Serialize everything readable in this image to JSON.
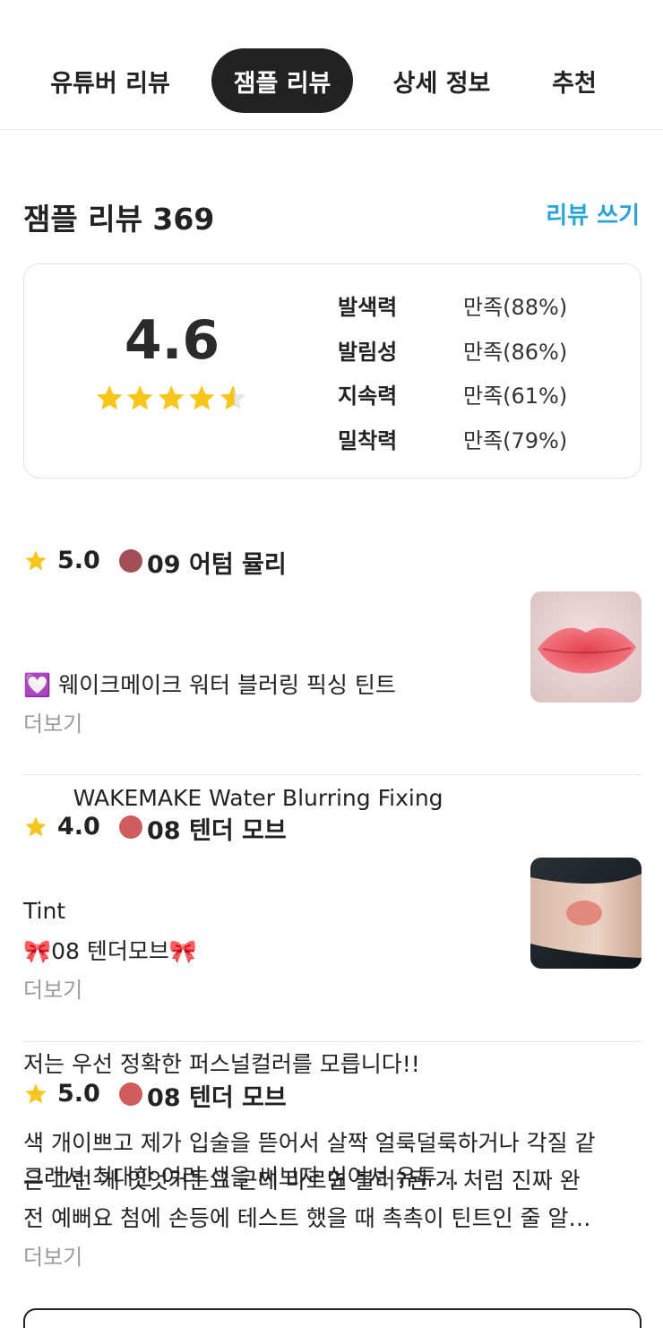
{
  "tabs": [
    {
      "label": "유튜버 리뷰",
      "active": false
    },
    {
      "label": "잼플 리뷰",
      "active": true
    },
    {
      "label": "상세 정보",
      "active": false
    },
    {
      "label": "추천",
      "active": false
    }
  ],
  "header": {
    "title": "잼플 리뷰 369",
    "write_link": "리뷰 쓰기"
  },
  "summary": {
    "average": "4.6",
    "average_value": 4.6,
    "star_count": 5,
    "stats": [
      {
        "label": "발색력",
        "value": "만족(88%)"
      },
      {
        "label": "발림성",
        "value": "만족(86%)"
      },
      {
        "label": "지속력",
        "value": "만족(61%)"
      },
      {
        "label": "밀착력",
        "value": "만족(79%)"
      }
    ]
  },
  "reviews": [
    {
      "score": "5.0",
      "shade": "09 어텀 뮬리",
      "swatch_color": "#a24f55",
      "lines": [
        "💟 웨이크메이크 워터 블러링 픽싱 틴트",
        "       WAKEMAKE Water Blurring Fixing",
        "Tint"
      ],
      "more": "더보기",
      "thumb": "lips-photo"
    },
    {
      "score": "4.0",
      "shade": "08 텐더 모브",
      "swatch_color": "#d05c5e",
      "lines": [
        "🎀08 텐더모브🎀",
        "저는 우선 정확한 퍼스널컬러를 모릅니다!!",
        "그래서 최대한 여러 색을 써보자 싶어서 유튜…"
      ],
      "more": "더보기",
      "thumb": "hand-swatch-photo"
    },
    {
      "score": "5.0",
      "shade": "08 텐더 모브",
      "swatch_color": "#d05c5e",
      "lines": [
        "색 개이쁘고 제가 입술을 뜯어서 살짝 얼룩덜룩하거나 각질 같",
        "은 그런 게 잇엇거든요 근데 바르면 블러?된 거 처럼 진짜 완",
        "전 예뻐요 첨에 손등에 테스트 했을 때 촉촉이 틴트인 줄 알…"
      ],
      "more": "더보기",
      "thumb": null
    }
  ],
  "colors": {
    "accent": "#2ba3d6",
    "star": "#f7c51c",
    "active_tab_bg": "#222222"
  }
}
